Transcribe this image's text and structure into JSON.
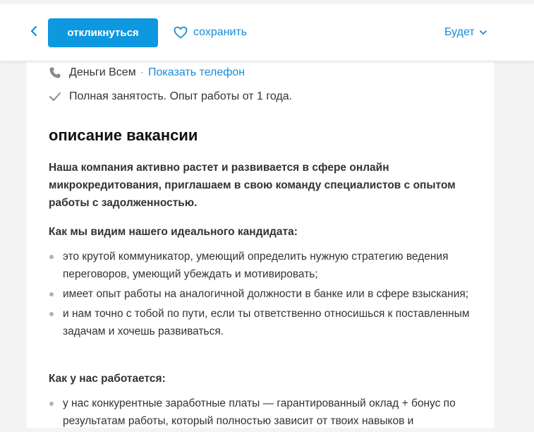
{
  "header": {
    "respond_label": "откликнуться",
    "save_label": "сохранить",
    "future_label": "Будет"
  },
  "meta": {
    "company": "Деньги Всем",
    "separator": "·",
    "phone_link": "Показать телефон",
    "employment": "Полная занятость. Опыт работы от 1 года."
  },
  "description": {
    "title": "описание вакансии",
    "intro": "Наша компания активно растет и развивается в сфере онлайн микрокредитования, приглашаем в свою команду специалистов с опытом работы с задолженностью.",
    "candidate_heading": "Как мы видим нашего идеального кандидата:",
    "candidate_items": [
      "это крутой коммуникатор, умеющий определить нужную стратегию ведения переговоров, умеющий убеждать и мотивировать;",
      "имеет опыт работы на аналогичной должности в банке или в сфере взыскания;",
      "и нам точно с тобой по пути, если ты ответственно относишься к поставленным задачам и хочешь развиваться."
    ],
    "work_heading": "Как у нас работается:",
    "work_items": [
      "у нас конкурентные заработные платы — гарантированный оклад + бонус по результатам работы, который полностью зависит от твоих навыков и"
    ]
  },
  "colors": {
    "accent": "#0d98e0",
    "link": "#1a8ad6",
    "background": "#f4f4f4",
    "text": "#333333"
  },
  "icons": {
    "back": "chevron-left-icon",
    "save": "heart-icon",
    "future_dropdown": "chevron-down-icon",
    "company": "phone-icon",
    "employment": "checkmark-icon"
  }
}
